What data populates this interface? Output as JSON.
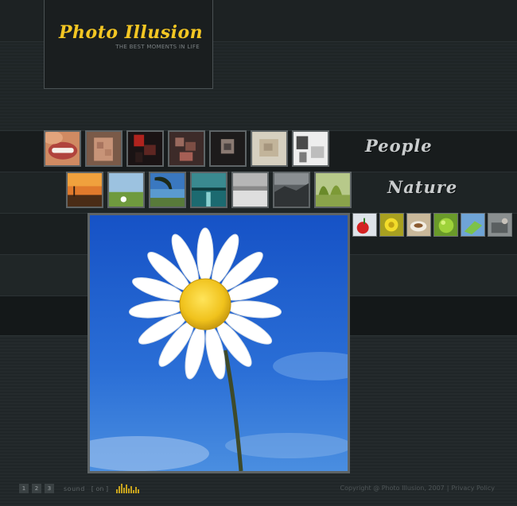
{
  "brand": {
    "title": "Photo Illusion",
    "tagline": "THE BEST MOMENTS IN LIFE"
  },
  "categories": [
    {
      "label": "People",
      "thumbnail_count": 7
    },
    {
      "label": "Nature",
      "thumbnail_count": 7
    },
    {
      "label": "",
      "thumbnail_count": 6
    }
  ],
  "main_photo": {
    "icon": "daisy-photo"
  },
  "footer": {
    "pages": [
      "1",
      "2",
      "3"
    ],
    "sound_label": "sound",
    "sound_state": "[ on ]",
    "copyright": "Copyright @ Photo Illusion,  2007",
    "separator": "|",
    "privacy": "Privacy Policy"
  },
  "colors": {
    "accent": "#f3c623",
    "background": "#1b2021",
    "border": "#5e6466"
  }
}
